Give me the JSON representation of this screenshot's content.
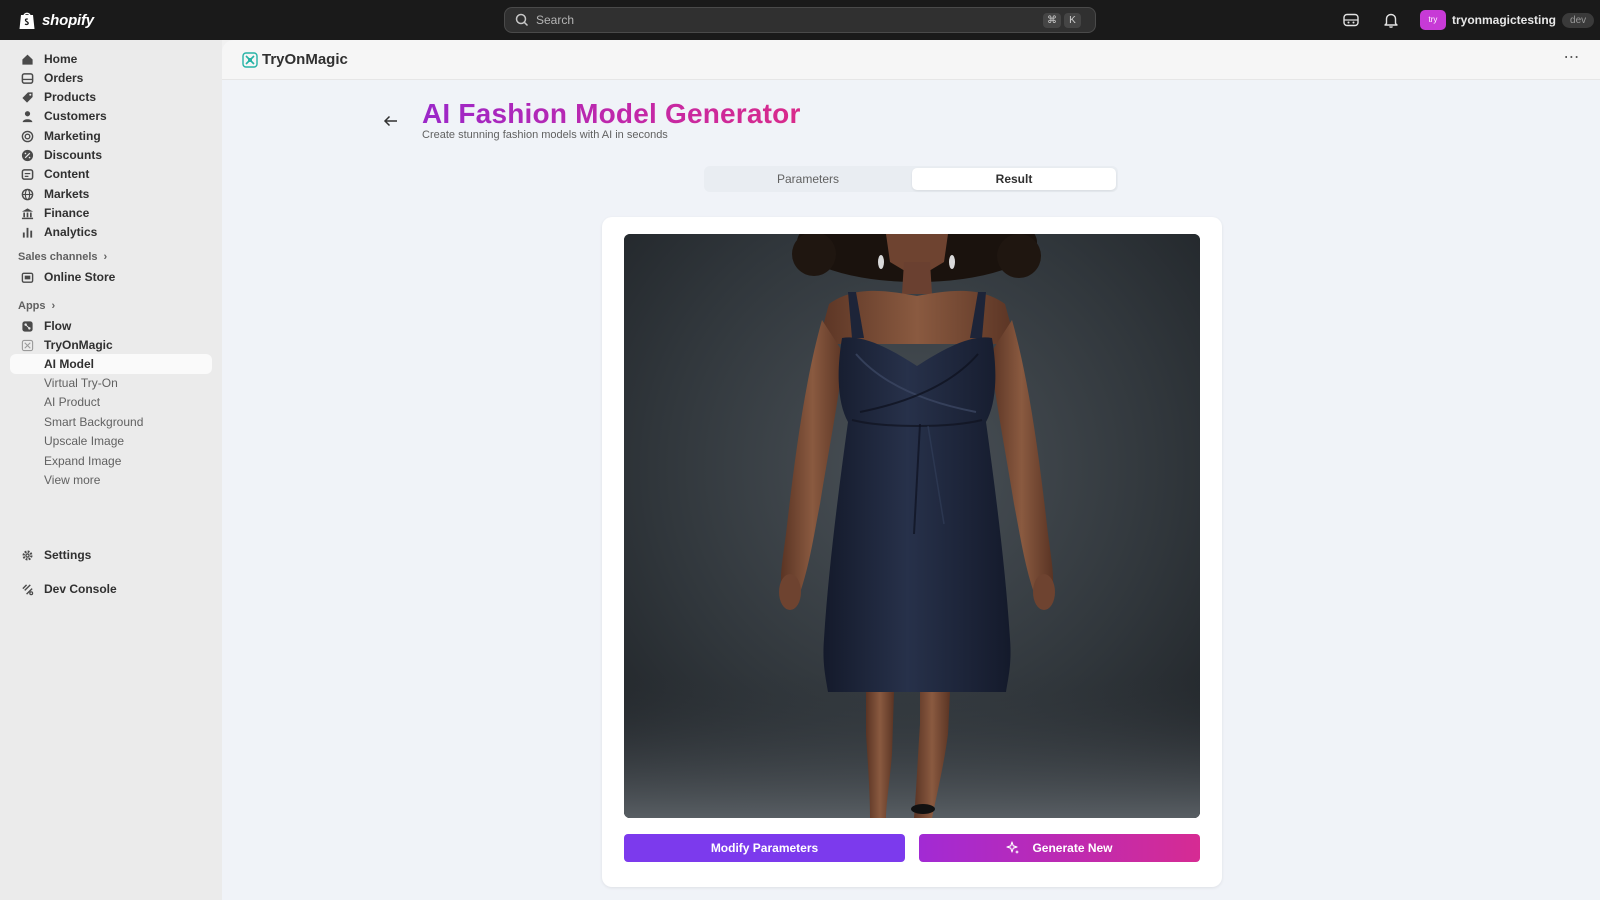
{
  "topbar": {
    "brand": "shopify",
    "search": {
      "placeholder": "Search",
      "shortcut_keys": [
        "⌘",
        "K"
      ]
    },
    "account": {
      "avatar_text": "try",
      "name": "tryonmagictesting",
      "badge": "dev"
    }
  },
  "sidebar": {
    "items": [
      {
        "label": "Home",
        "icon": "home-icon"
      },
      {
        "label": "Orders",
        "icon": "inbox-icon"
      },
      {
        "label": "Products",
        "icon": "tag-icon"
      },
      {
        "label": "Customers",
        "icon": "person-icon"
      },
      {
        "label": "Marketing",
        "icon": "target-icon"
      },
      {
        "label": "Discounts",
        "icon": "discount-icon"
      },
      {
        "label": "Content",
        "icon": "content-icon"
      },
      {
        "label": "Markets",
        "icon": "globe-icon"
      },
      {
        "label": "Finance",
        "icon": "bank-icon"
      },
      {
        "label": "Analytics",
        "icon": "bar-chart-icon"
      }
    ],
    "sales_channels_label": "Sales channels",
    "online_store": "Online Store",
    "apps_label": "Apps",
    "flow": "Flow",
    "tryonmagic": "TryOnMagic",
    "ai_model": "AI Model",
    "subitems": [
      "Virtual Try-On",
      "AI Product",
      "Smart Background",
      "Upscale Image",
      "Expand Image",
      "View more"
    ],
    "settings": "Settings",
    "dev_console": "Dev Console"
  },
  "app": {
    "name": "TryOnMagic",
    "page_title": "AI Fashion Model Generator",
    "page_subtitle": "Create stunning fashion models with AI in seconds",
    "tabs": [
      {
        "label": "Parameters",
        "active": false
      },
      {
        "label": "Result",
        "active": true
      }
    ],
    "result_image": "generated-fashion-model-navy-dress",
    "modify_button": "Modify Parameters",
    "generate_button": "Generate New"
  },
  "colors": {
    "topbar_bg": "#1a1a1a",
    "accent_purple": "#7c3aed",
    "gradient_start": "#a22ad4",
    "gradient_end": "#d62b93",
    "title_gradient": "#9b27c9"
  }
}
